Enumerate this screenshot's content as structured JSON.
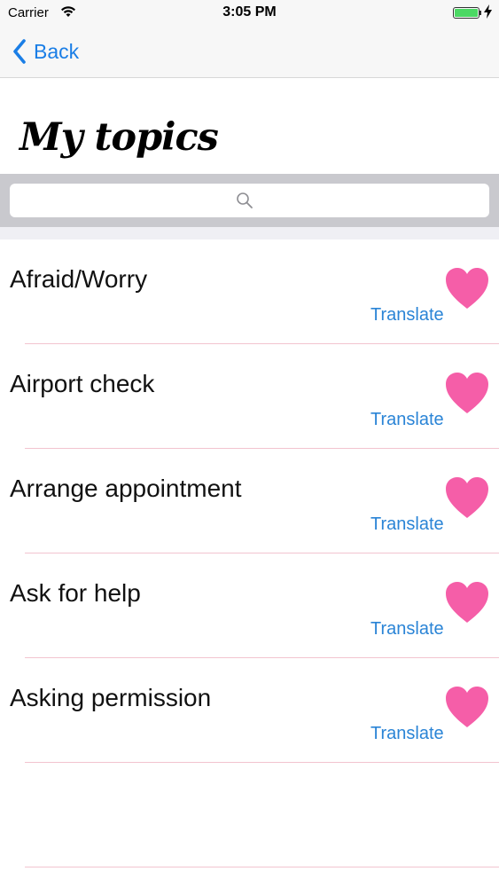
{
  "status_bar": {
    "carrier": "Carrier",
    "time": "3:05 PM",
    "battery_color": "#4cd964"
  },
  "nav": {
    "back_label": "Back",
    "accent_color": "#1a7ee6"
  },
  "header": {
    "title": "My topics"
  },
  "search": {
    "placeholder": ""
  },
  "topics": [
    {
      "label": "Afraid/Worry",
      "translate_label": "Translate"
    },
    {
      "label": "Airport check",
      "translate_label": "Translate"
    },
    {
      "label": "Arrange appointment",
      "translate_label": "Translate"
    },
    {
      "label": "Ask for help",
      "translate_label": "Translate"
    },
    {
      "label": "Asking permission",
      "translate_label": "Translate"
    }
  ],
  "colors": {
    "heart": "#f55ea8",
    "translate": "#2a84d6",
    "separator": "#f2c4cf"
  }
}
